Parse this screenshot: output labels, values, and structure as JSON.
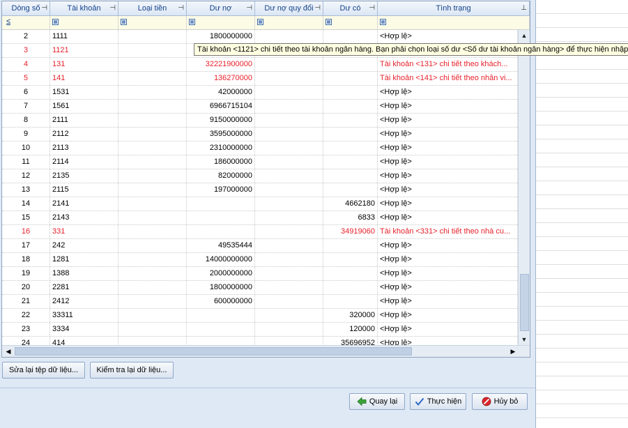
{
  "columns": [
    "Dòng số",
    "Tài khoản",
    "Loại tiền",
    "Dư nợ",
    "Dư nợ quy đổi",
    "Dư có",
    "Tình trạng"
  ],
  "filter_operator": "≤",
  "rows": [
    {
      "no": "2",
      "account": "1111",
      "currency": "",
      "debit": "1800000000",
      "debit_conv": "",
      "credit": "",
      "status": "<Hợp lệ>",
      "error": false
    },
    {
      "no": "3",
      "account": "1121",
      "currency": "",
      "debit": "",
      "debit_conv": "",
      "credit": "",
      "status": "",
      "error": true
    },
    {
      "no": "4",
      "account": "131",
      "currency": "",
      "debit": "32221900000",
      "debit_conv": "",
      "credit": "",
      "status": "Tài khoản <131> chi tiết theo khách...",
      "error": true
    },
    {
      "no": "5",
      "account": "141",
      "currency": "",
      "debit": "136270000",
      "debit_conv": "",
      "credit": "",
      "status": "Tài khoản <141> chi tiết theo nhân vi...",
      "error": true
    },
    {
      "no": "6",
      "account": "1531",
      "currency": "",
      "debit": "42000000",
      "debit_conv": "",
      "credit": "",
      "status": "<Hợp lệ>",
      "error": false
    },
    {
      "no": "7",
      "account": "1561",
      "currency": "",
      "debit": "6966715104",
      "debit_conv": "",
      "credit": "",
      "status": "<Hợp lệ>",
      "error": false
    },
    {
      "no": "8",
      "account": "2111",
      "currency": "",
      "debit": "9150000000",
      "debit_conv": "",
      "credit": "",
      "status": "<Hợp lệ>",
      "error": false
    },
    {
      "no": "9",
      "account": "2112",
      "currency": "",
      "debit": "3595000000",
      "debit_conv": "",
      "credit": "",
      "status": "<Hợp lệ>",
      "error": false
    },
    {
      "no": "10",
      "account": "2113",
      "currency": "",
      "debit": "2310000000",
      "debit_conv": "",
      "credit": "",
      "status": "<Hợp lệ>",
      "error": false
    },
    {
      "no": "11",
      "account": "2114",
      "currency": "",
      "debit": "186000000",
      "debit_conv": "",
      "credit": "",
      "status": "<Hợp lệ>",
      "error": false
    },
    {
      "no": "12",
      "account": "2135",
      "currency": "",
      "debit": "82000000",
      "debit_conv": "",
      "credit": "",
      "status": "<Hợp lệ>",
      "error": false
    },
    {
      "no": "13",
      "account": "2115",
      "currency": "",
      "debit": "197000000",
      "debit_conv": "",
      "credit": "",
      "status": "<Hợp lệ>",
      "error": false
    },
    {
      "no": "14",
      "account": "2141",
      "currency": "",
      "debit": "",
      "debit_conv": "",
      "credit": "4662180",
      "status": "<Hợp lệ>",
      "error": false
    },
    {
      "no": "15",
      "account": "2143",
      "currency": "",
      "debit": "",
      "debit_conv": "",
      "credit": "6833",
      "status": "<Hợp lệ>",
      "error": false
    },
    {
      "no": "16",
      "account": "331",
      "currency": "",
      "debit": "",
      "debit_conv": "",
      "credit": "34919060",
      "status": "Tài khoản <331> chi tiết theo nhà cu...",
      "error": true
    },
    {
      "no": "17",
      "account": "242",
      "currency": "",
      "debit": "49535444",
      "debit_conv": "",
      "credit": "",
      "status": "<Hợp lệ>",
      "error": false
    },
    {
      "no": "18",
      "account": "1281",
      "currency": "",
      "debit": "14000000000",
      "debit_conv": "",
      "credit": "",
      "status": "<Hợp lệ>",
      "error": false
    },
    {
      "no": "19",
      "account": "1388",
      "currency": "",
      "debit": "2000000000",
      "debit_conv": "",
      "credit": "",
      "status": "<Hợp lệ>",
      "error": false
    },
    {
      "no": "20",
      "account": "2281",
      "currency": "",
      "debit": "1800000000",
      "debit_conv": "",
      "credit": "",
      "status": "<Hợp lệ>",
      "error": false
    },
    {
      "no": "21",
      "account": "2412",
      "currency": "",
      "debit": "600000000",
      "debit_conv": "",
      "credit": "",
      "status": "<Hợp lệ>",
      "error": false
    },
    {
      "no": "22",
      "account": "33311",
      "currency": "",
      "debit": "",
      "debit_conv": "",
      "credit": "320000",
      "status": "<Hợp lệ>",
      "error": false
    },
    {
      "no": "23",
      "account": "3334",
      "currency": "",
      "debit": "",
      "debit_conv": "",
      "credit": "120000",
      "status": "<Hợp lệ>",
      "error": false
    },
    {
      "no": "24",
      "account": "414",
      "currency": "",
      "debit": "",
      "debit_conv": "",
      "credit": "35696952",
      "status": "<Hợp lệ>",
      "error": false
    }
  ],
  "tooltip": "Tài khoản <1121> chi tiết theo tài khoản ngân hàng. Bạn phải chọn loại số dư <Số dư tài khoản ngân hàng> để thực hiện nhập",
  "buttons": {
    "edit_file": "Sửa lại tệp dữ liệu...",
    "recheck": "Kiểm tra lại dữ liệu...",
    "back": "Quay lại",
    "execute": "Thực hiện",
    "cancel": "Hủy bỏ"
  },
  "colors": {
    "error_text": "#e8212b",
    "header_text": "#15428b",
    "accent": "#dfe9f5"
  }
}
